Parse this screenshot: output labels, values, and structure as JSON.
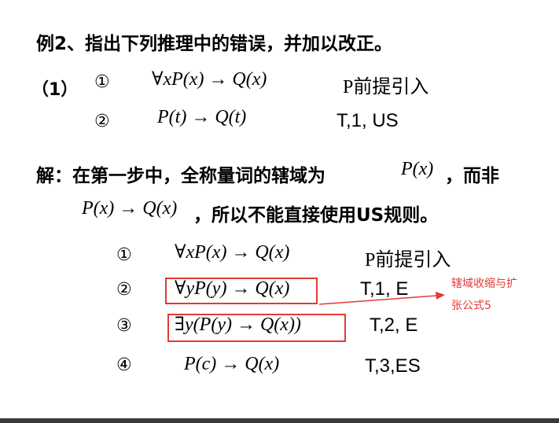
{
  "title": "例2、指出下列推理中的错误，并加以改正。",
  "part_label": "（1）",
  "original": [
    {
      "num": "①",
      "formula": "∀xP(x) → Q(x)",
      "rule": "P前提引入"
    },
    {
      "num": "②",
      "formula": "P(t) → Q(t)",
      "rule": "T,1, US"
    }
  ],
  "solution": {
    "line1_prefix": "解：在第一步中，全称量词的辖域为",
    "line1_formula": "P(x)",
    "line1_suffix": "，而非",
    "line2_formula": "P(x) → Q(x)",
    "line2_suffix": "，所以不能直接使用US规则。"
  },
  "corrected": [
    {
      "num": "①",
      "formula": "∀xP(x) → Q(x)",
      "rule": "P前提引入"
    },
    {
      "num": "②",
      "formula": "∀yP(y) → Q(x)",
      "rule": "T,1, E"
    },
    {
      "num": "③",
      "formula": "∃y(P(y) → Q(x))",
      "rule": "T,2, E"
    },
    {
      "num": "④",
      "formula": "P(c) → Q(x)",
      "rule": "T,3,ES"
    }
  ],
  "annotation": {
    "line1": "辖域收缩与扩",
    "line2": "张公式5"
  },
  "colors": {
    "accent": "#e53935",
    "text": "#000000",
    "bottom_bar": "#3a3a3a"
  }
}
